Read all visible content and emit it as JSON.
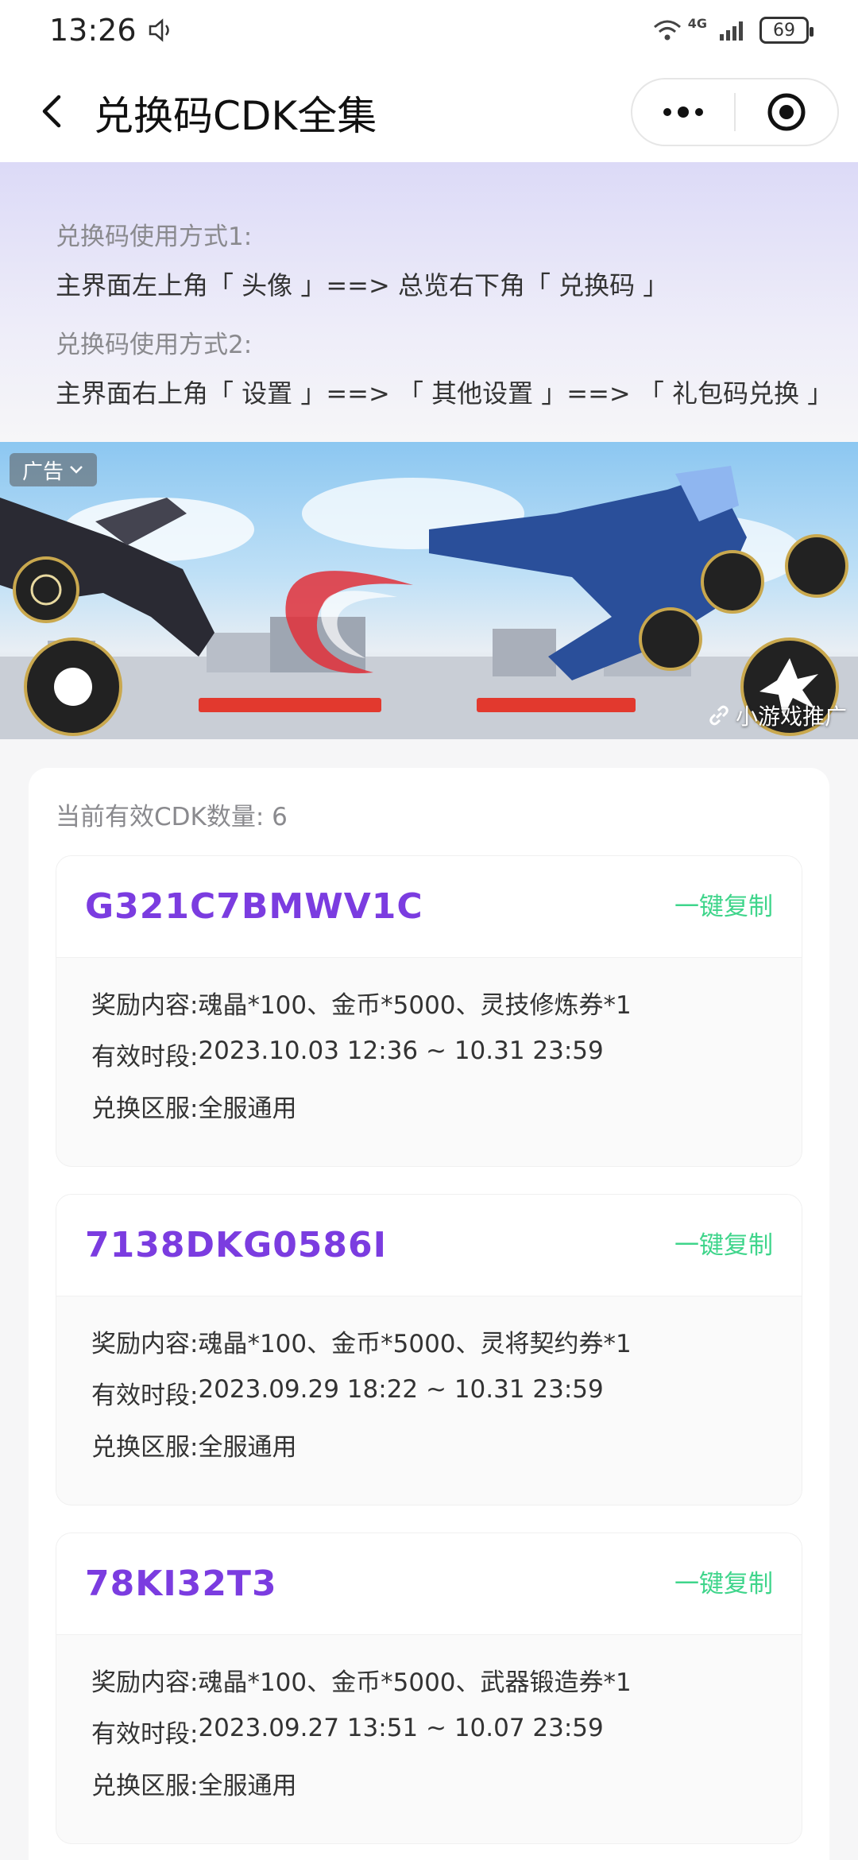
{
  "status": {
    "time": "13:26",
    "network": "4G",
    "battery": "69"
  },
  "nav": {
    "title": "兑换码CDK全集"
  },
  "guide": {
    "method1_label": "兑换码使用方式1:",
    "method1_text": "主界面左上角「 头像 」==> 总览右下角「 兑换码 」",
    "method2_label": "兑换码使用方式2:",
    "method2_text": "主界面右上角「 设置 」==> 「 其他设置 」==> 「 礼包码兑换 」"
  },
  "ad": {
    "tag": "广告",
    "promo": "小游戏推广"
  },
  "list": {
    "count_label": "当前有效CDK数量: 6",
    "copy_label": "一键复制",
    "reward_key": "奖励内容:",
    "period_key": "有效时段:",
    "server_key": "兑换区服:",
    "items": [
      {
        "code": "G321C7BMWV1C",
        "reward": "魂晶*100、金币*5000、灵技修炼券*1",
        "period": "2023.10.03 12:36 ~ 10.31 23:59",
        "server": "全服通用"
      },
      {
        "code": "7138DKG0586I",
        "reward": "魂晶*100、金币*5000、灵将契约券*1",
        "period": "2023.09.29 18:22 ~ 10.31 23:59",
        "server": "全服通用"
      },
      {
        "code": "78KI32T3",
        "reward": "魂晶*100、金币*5000、武器锻造券*1",
        "period": "2023.09.27 13:51 ~ 10.07 23:59",
        "server": "全服通用"
      }
    ]
  },
  "colors": {
    "code": "#7b3ce0",
    "copy": "#3fd58b"
  }
}
